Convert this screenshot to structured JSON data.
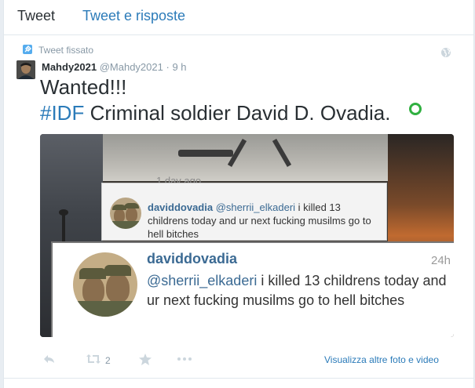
{
  "tabs": {
    "tweets": "Tweet",
    "replies": "Tweet e risposte"
  },
  "pinned": {
    "label": "Tweet fissato"
  },
  "tweet": {
    "fullname": "Mahdy2021",
    "handle": "@Mahdy2021",
    "separator": "·",
    "time": "9 h",
    "line1": "Wanted!!!",
    "hashtag": "#IDF",
    "line2_rest": " Criminal soldier David D. Ovadia."
  },
  "media": {
    "faded_day": "1 day ago",
    "card1": {
      "username": "daviddovadia",
      "mention": "@sherrii_elkaderi",
      "text": " i killed 13 childrens today and ur next fucking musilms go to hell bitches"
    },
    "card2": {
      "username": "daviddovadia",
      "age": "24h",
      "mention": "@sherrii_elkaderi",
      "text": " i killed 13 childrens today and ur next fucking musilms go to hell bitches"
    }
  },
  "actions": {
    "retweet_count": "2",
    "more_link": "Visualizza altre foto e video"
  },
  "icons": {
    "pin": "pin-icon",
    "globe": "globe-icon",
    "reply": "reply-icon",
    "retweet": "retweet-icon",
    "favorite": "star-icon",
    "more": "more-icon"
  },
  "colors": {
    "link": "#2b7bb9",
    "meta": "#8899a6",
    "text": "#292f33"
  }
}
